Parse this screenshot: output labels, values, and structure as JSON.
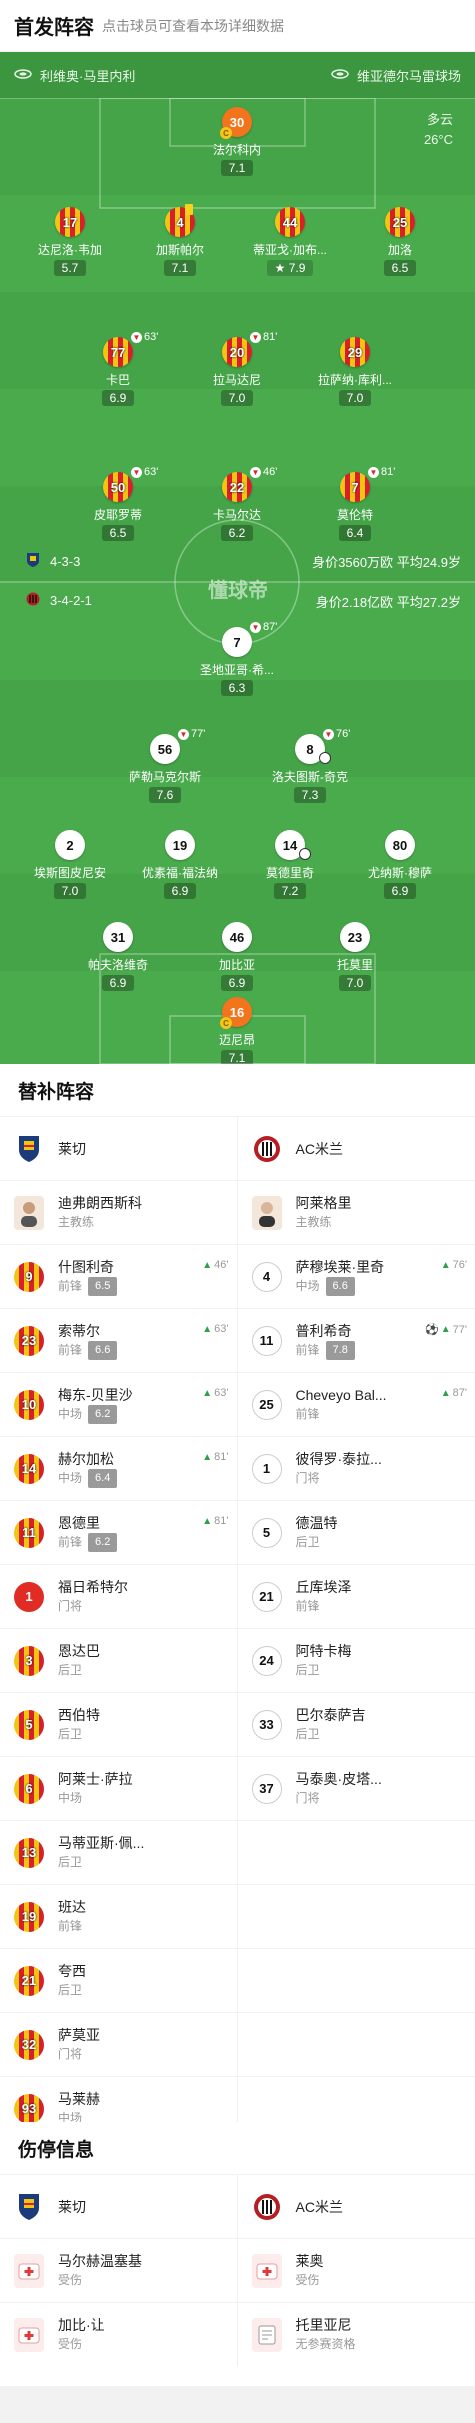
{
  "header": {
    "title": "首发阵容",
    "subtitle": "点击球员可查看本场详细数据"
  },
  "venue": {
    "home_team": "利维奥·马里内利",
    "away_team": "维亚德尔马雷球场"
  },
  "weather": {
    "desc": "多云",
    "temp": "26°C"
  },
  "home_formation": {
    "formation": "4-3-3",
    "value": "身价3560万欧",
    "age": "平均24.9岁"
  },
  "away_formation": {
    "formation": "3-4-2-1",
    "value": "身价2.18亿欧",
    "age": "平均27.2岁"
  },
  "watermark": "懂球帝",
  "home_players": [
    {
      "num": "30",
      "name": "法尔科内",
      "rating": "7.1",
      "gk": true,
      "captain": true
    },
    {
      "num": "17",
      "name": "达尼洛·韦加",
      "rating": "5.7"
    },
    {
      "num": "4",
      "name": "加斯帕尔",
      "rating": "7.1",
      "card": true
    },
    {
      "num": "44",
      "name": "蒂亚戈·加布...",
      "rating": "7.9",
      "star": true
    },
    {
      "num": "25",
      "name": "加洛",
      "rating": "6.5"
    },
    {
      "num": "77",
      "name": "卡巴",
      "rating": "6.9",
      "sub": "63'"
    },
    {
      "num": "20",
      "name": "拉马达尼",
      "rating": "7.0",
      "sub": "81'"
    },
    {
      "num": "29",
      "name": "拉萨纳·库利...",
      "rating": "7.0"
    },
    {
      "num": "50",
      "name": "皮耶罗蒂",
      "rating": "6.5",
      "sub": "63'"
    },
    {
      "num": "22",
      "name": "卡马尔达",
      "rating": "6.2",
      "sub": "46'"
    },
    {
      "num": "7",
      "name": "莫伦特",
      "rating": "6.4",
      "sub": "81'"
    }
  ],
  "away_players": [
    {
      "num": "7",
      "name": "圣地亚哥·希...",
      "rating": "6.3",
      "sub": "87'"
    },
    {
      "num": "56",
      "name": "萨勒马克尔斯",
      "rating": "7.6",
      "sub": "77'"
    },
    {
      "num": "8",
      "name": "洛夫图斯-奇克",
      "rating": "7.3",
      "sub": "76'",
      "ball": true
    },
    {
      "num": "2",
      "name": "埃斯图皮尼安",
      "rating": "7.0"
    },
    {
      "num": "19",
      "name": "优素福·福法纳",
      "rating": "6.9"
    },
    {
      "num": "14",
      "name": "莫德里奇",
      "rating": "7.2",
      "ball": true
    },
    {
      "num": "80",
      "name": "尤纳斯·穆萨",
      "rating": "6.9"
    },
    {
      "num": "31",
      "name": "帕夫洛维奇",
      "rating": "6.9"
    },
    {
      "num": "46",
      "name": "加比亚",
      "rating": "6.9"
    },
    {
      "num": "23",
      "name": "托莫里",
      "rating": "7.0"
    },
    {
      "num": "16",
      "name": "迈尼昂",
      "rating": "7.1",
      "gk": true,
      "captain": true
    }
  ],
  "subs": {
    "title": "替补阵容",
    "home_team": "莱切",
    "away_team": "AC米兰",
    "home_coach": {
      "name": "迪弗朗西斯科",
      "role": "主教练"
    },
    "away_coach": {
      "name": "阿莱格里",
      "role": "主教练"
    },
    "home": [
      {
        "num": "9",
        "name": "什图利奇",
        "pos": "前锋",
        "rating": "6.5",
        "in": "46'"
      },
      {
        "num": "23",
        "name": "索蒂尔",
        "pos": "前锋",
        "rating": "6.6",
        "in": "63'"
      },
      {
        "num": "10",
        "name": "梅东-贝里沙",
        "pos": "中场",
        "rating": "6.2",
        "in": "63'"
      },
      {
        "num": "14",
        "name": "赫尔加松",
        "pos": "中场",
        "rating": "6.4",
        "in": "81'"
      },
      {
        "num": "11",
        "name": "恩德里",
        "pos": "前锋",
        "rating": "6.2",
        "in": "81'"
      },
      {
        "num": "1",
        "name": "福日希特尔",
        "pos": "门将",
        "gk": true
      },
      {
        "num": "3",
        "name": "恩达巴",
        "pos": "后卫"
      },
      {
        "num": "5",
        "name": "西伯特",
        "pos": "后卫"
      },
      {
        "num": "6",
        "name": "阿莱士·萨拉",
        "pos": "中场"
      },
      {
        "num": "13",
        "name": "马蒂亚斯·佩...",
        "pos": "后卫"
      },
      {
        "num": "19",
        "name": "班达",
        "pos": "前锋"
      },
      {
        "num": "21",
        "name": "夸西",
        "pos": "后卫"
      },
      {
        "num": "32",
        "name": "萨莫亚",
        "pos": "门将"
      },
      {
        "num": "93",
        "name": "马莱赫",
        "pos": "中场"
      }
    ],
    "away": [
      {
        "num": "4",
        "name": "萨穆埃莱·里奇",
        "pos": "中场",
        "rating": "6.6",
        "in": "76'"
      },
      {
        "num": "11",
        "name": "普利希奇",
        "pos": "前锋",
        "rating": "7.8",
        "in": "77'",
        "ball": true
      },
      {
        "num": "25",
        "name": "Cheveyo Bal...",
        "pos": "前锋",
        "in": "87'"
      },
      {
        "num": "1",
        "name": "彼得罗·泰拉...",
        "pos": "门将"
      },
      {
        "num": "5",
        "name": "德温特",
        "pos": "后卫"
      },
      {
        "num": "21",
        "name": "丘库埃泽",
        "pos": "前锋"
      },
      {
        "num": "24",
        "name": "阿特卡梅",
        "pos": "后卫"
      },
      {
        "num": "33",
        "name": "巴尔泰萨吉",
        "pos": "后卫"
      },
      {
        "num": "37",
        "name": "马泰奥·皮塔...",
        "pos": "门将"
      }
    ]
  },
  "injury": {
    "title": "伤停信息",
    "home_team": "莱切",
    "away_team": "AC米兰",
    "home": [
      {
        "name": "马尔赫温塞基",
        "status": "受伤"
      },
      {
        "name": "加比·让",
        "status": "受伤"
      }
    ],
    "away": [
      {
        "name": "莱奥",
        "status": "受伤"
      },
      {
        "name": "托里亚尼",
        "status": "无参赛资格"
      }
    ]
  },
  "colors": {
    "pitch": "#47a84a",
    "lecce_yellow": "#f3c513",
    "lecce_red": "#d8202a",
    "gk_orange": "#f2741d"
  }
}
